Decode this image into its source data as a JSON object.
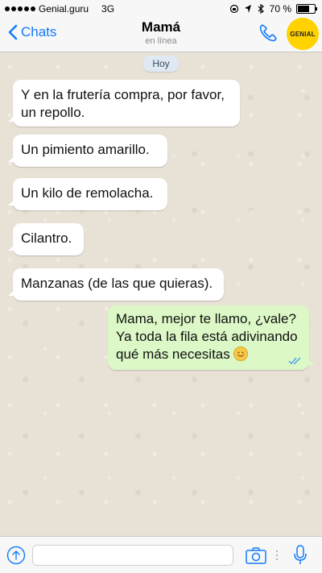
{
  "status": {
    "carrier": "Genial.guru",
    "network": "3G",
    "battery": "70 %",
    "battery_level": 0.7
  },
  "header": {
    "back_label": "Chats",
    "title": "Mamá",
    "subtitle": "en línea",
    "logo_text": "GENIAL"
  },
  "chat": {
    "day": "Hoy",
    "messages": [
      {
        "direction": "in",
        "text_lines": [
          "Y en la frutería compra, por favor,",
          "un repollo."
        ]
      },
      {
        "direction": "in",
        "text": "Un pimiento amarillo."
      },
      {
        "direction": "in",
        "text": "Un kilo de remolacha."
      },
      {
        "direction": "in",
        "text": "Cilantro."
      },
      {
        "direction": "in",
        "text": "Manzanas (de las que quieras)."
      },
      {
        "direction": "out",
        "text_lines": [
          "Mama, mejor te llamo, ¿vale?",
          "Ya toda la fila está adivinando",
          "qué más necesitas"
        ],
        "emoji": "smiling-face",
        "status": "read"
      }
    ]
  },
  "input": {
    "placeholder": ""
  },
  "colors": {
    "accent": "#127afb",
    "incoming_bubble": "#ffffff",
    "outgoing_bubble": "#dcf8c6",
    "logo_bg": "#ffd200"
  }
}
